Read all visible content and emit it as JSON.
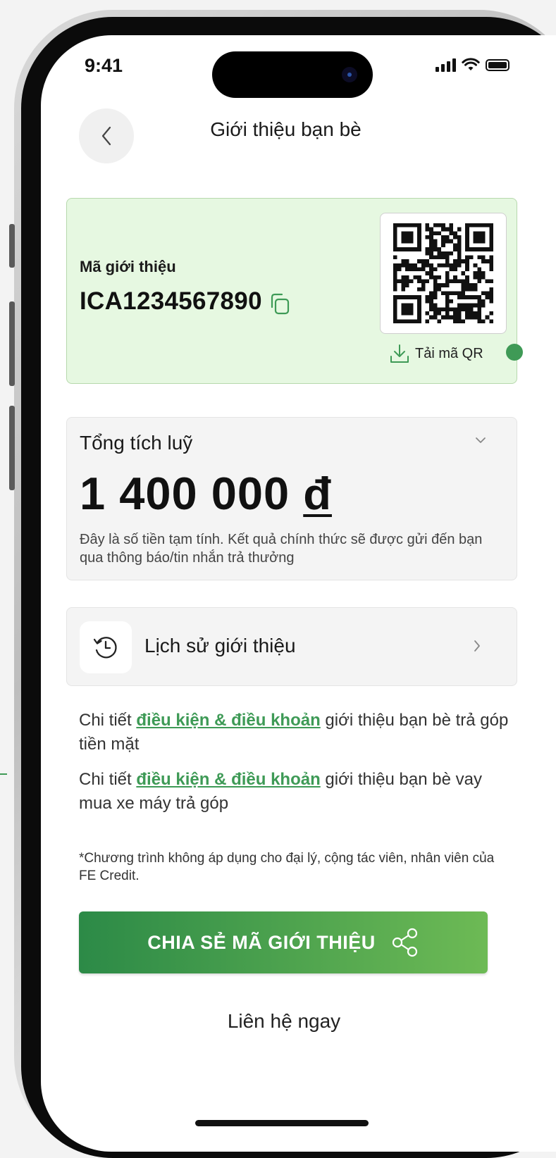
{
  "status": {
    "time": "9:41"
  },
  "header": {
    "title": "Giới thiệu bạn bè"
  },
  "referral": {
    "label": "Mã giới thiệu",
    "code": "ICA1234567890",
    "download_label": "Tải mã QR"
  },
  "total": {
    "label": "Tổng tích luỹ",
    "amount": "1 400 000",
    "currency": "đ",
    "note": "Đây là số tiền tạm tính. Kết quả chính thức sẽ được gửi đến bạn qua thông báo/tin nhắn trả thưởng"
  },
  "history": {
    "label": "Lịch sử giới thiệu"
  },
  "terms": [
    {
      "prefix": "Chi tiết ",
      "link": "điều kiện & điều khoản",
      "suffix": " giới thiệu bạn bè trả góp tiền mặt"
    },
    {
      "prefix": "Chi tiết ",
      "link": "điều kiện & điều khoản",
      "suffix": " giới thiệu bạn bè vay mua xe máy trả góp"
    }
  ],
  "disclaimer": "*Chương trình không áp dụng cho đại lý, cộng tác viên, nhân viên của FE Credit.",
  "share_button": {
    "label": "CHIA SẺ MÃ GIỚI THIỆU"
  },
  "contact_link": "Liên hệ ngay",
  "colors": {
    "accent": "#3e9a56",
    "card_green": "#e6f8e1",
    "card_gray": "#f4f4f4"
  },
  "icons": [
    "back-chevron-icon",
    "copy-icon",
    "qr-code-icon",
    "download-icon",
    "chevron-down-icon",
    "history-clock-icon",
    "chevron-right-icon",
    "share-icon",
    "signal-icon",
    "wifi-icon",
    "battery-icon"
  ]
}
